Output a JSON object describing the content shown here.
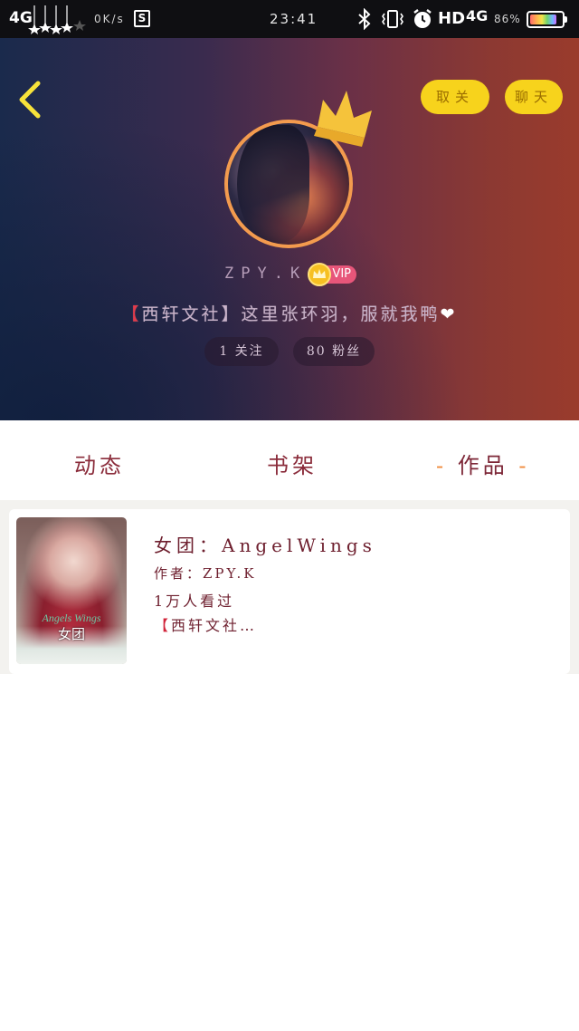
{
  "status_bar": {
    "network_left": "4G",
    "speed": "0K/s",
    "sim_icon": "S",
    "time": "23:41",
    "hd": "HD",
    "network_right": "4G",
    "battery_percent": "86%",
    "battery_level": 0.86,
    "icons": [
      "signal-stars-icon",
      "sim-s-icon",
      "bluetooth-icon",
      "vibrate-icon",
      "alarm-icon",
      "battery-icon"
    ]
  },
  "header": {
    "back_icon": "chevron-left-icon",
    "unfollow_label": "取关",
    "chat_label": "聊天",
    "username": "ZPY.K",
    "vip_label": "VIP",
    "bio_open": "【",
    "bio_main": "西轩文社】这里张环羽，服就我鸭",
    "heart": "❤",
    "following": "1 关注",
    "fans": "80 粉丝",
    "colors": {
      "pill_bg": "#f7d31c",
      "gradient_left": "#1a2a4c",
      "gradient_right": "#9a3b2c",
      "avatar_ring": "#f39b4e",
      "vip_pink": "#e7567a"
    }
  },
  "tabs": {
    "dynamics": "动态",
    "bookshelf": "书架",
    "works": "作品",
    "dash": "-",
    "active": "works"
  },
  "works": [
    {
      "title": "女团：AngelWings",
      "author": "作者：ZPY.K",
      "views": "1万人看过",
      "desc_mark": "【",
      "desc": "西轩文社…",
      "cover_text_en": "Angels Wings",
      "cover_text_cn": "女团"
    }
  ]
}
